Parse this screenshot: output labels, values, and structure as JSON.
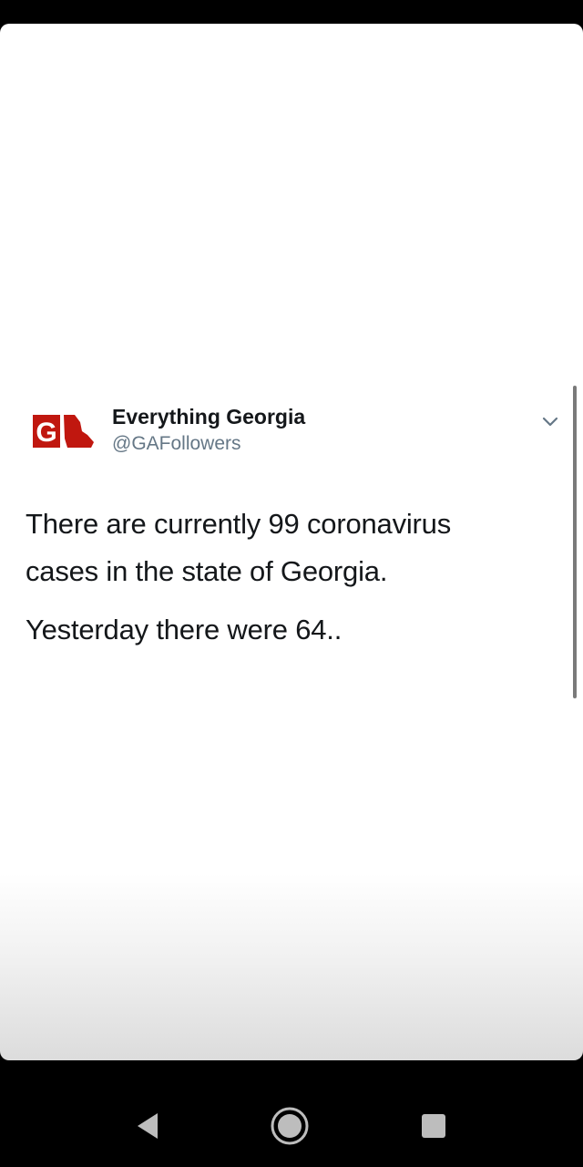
{
  "tweet": {
    "author_name": "Everything Georgia",
    "author_handle": "@GAFollowers",
    "avatar_icon": "everything-georgia-logo",
    "avatar_letter": "G",
    "avatar_color": "#c0170f",
    "menu_icon": "chevron-down-icon",
    "lines": [
      "There are currently 99 coronavirus",
      "cases in the state of Georgia.",
      "Yesterday there were 64.."
    ]
  },
  "navigation": {
    "back_icon": "back-triangle-icon",
    "home_icon": "home-circle-icon",
    "recents_icon": "recents-square-icon",
    "icon_color": "#bdbdbd"
  }
}
